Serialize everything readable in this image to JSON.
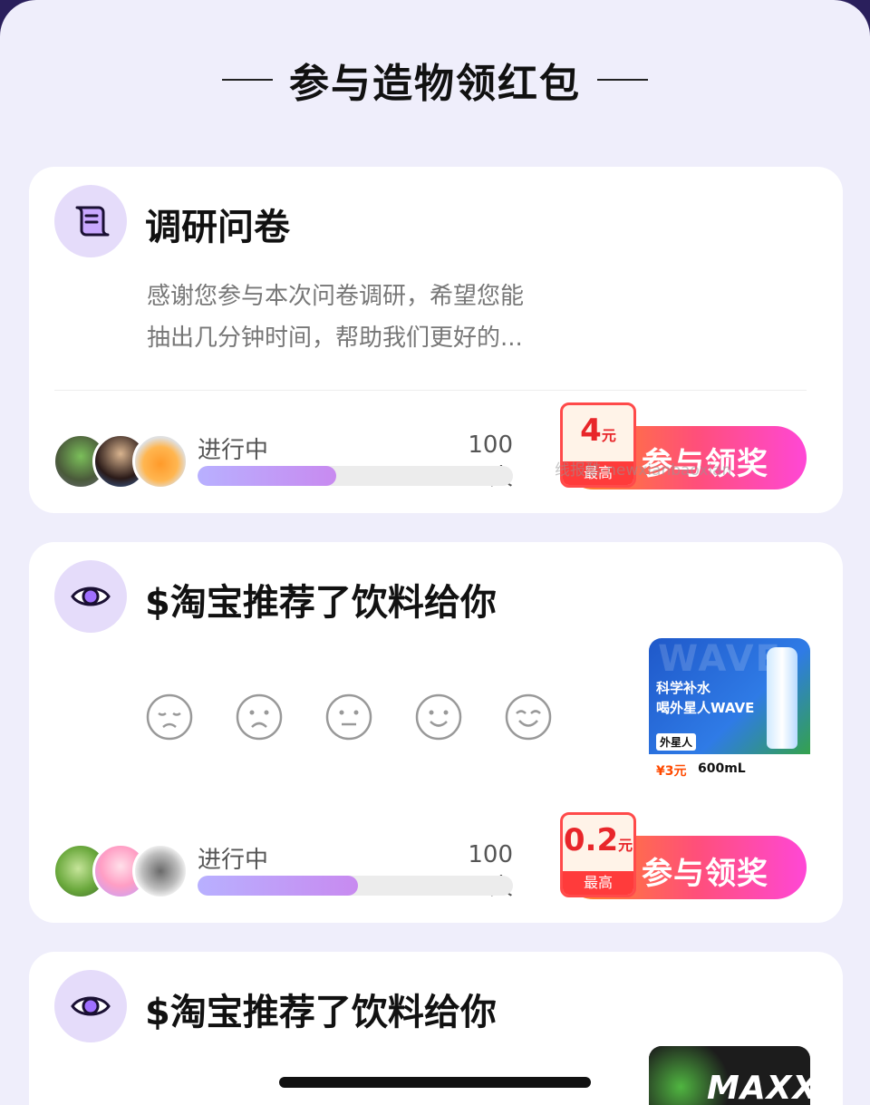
{
  "header": {
    "title": "参与造物领红包"
  },
  "cards": [
    {
      "icon": "scroll-icon",
      "title": "调研问卷",
      "description_line1": "感谢您参与本次问卷调研，希望您能",
      "description_line2": "抽出几分钟时间，帮助我们更好的...",
      "status": "进行中",
      "count": "100人",
      "progress_percent": 44,
      "reward_amount": "4",
      "reward_unit": "元",
      "reward_label": "最高",
      "cta_label": "参与领奖"
    },
    {
      "icon": "eye-icon",
      "title": "$淘宝推荐了饮料给你",
      "rating_faces": [
        "very-sad-face-icon",
        "sad-face-icon",
        "neutral-face-icon",
        "smile-face-icon",
        "happy-face-icon"
      ],
      "promo": {
        "watermark": "WAVE",
        "line1": "科学补水",
        "line2": "喝外星人WAVE",
        "brand": "外星人",
        "price": "¥3元",
        "volume": "600mL"
      },
      "status": "进行中",
      "count": "100人",
      "progress_percent": 51,
      "reward_amount": "0.2",
      "reward_unit": "元",
      "reward_label": "最高",
      "cta_label": "参与领奖"
    },
    {
      "icon": "eye-icon",
      "title": "$淘宝推荐了饮料给你",
      "promo": {
        "brand": "MAXX"
      }
    }
  ],
  "watermark": "线报酷-newxianbaoxian",
  "colors": {
    "accent_purple": "#c88af0",
    "cta_start": "#ff8a1c",
    "cta_end": "#ff47d6",
    "reward_red": "#e8262a"
  }
}
